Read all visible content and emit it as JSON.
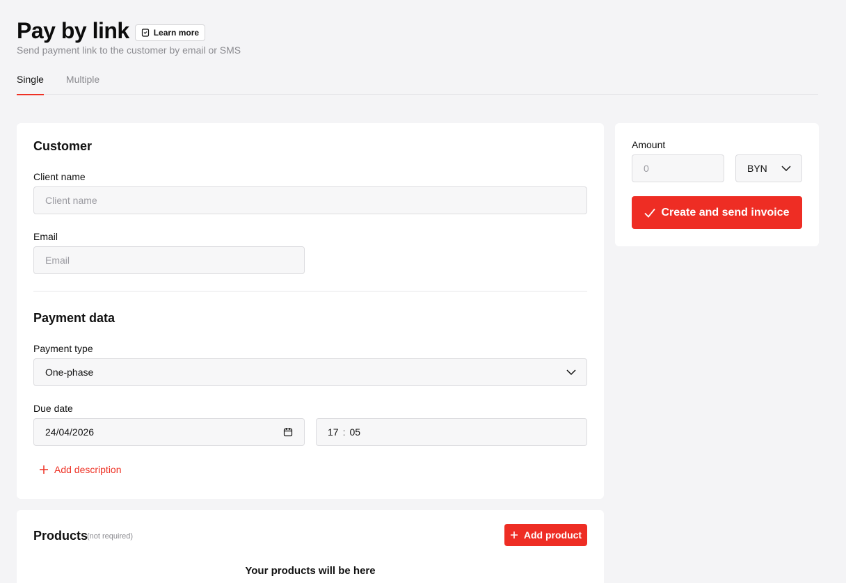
{
  "header": {
    "title": "Pay by link",
    "learn_more": "Learn more",
    "subtitle": "Send payment link to the customer by email or SMS"
  },
  "tabs": [
    {
      "label": "Single",
      "active": true
    },
    {
      "label": "Multiple",
      "active": false
    }
  ],
  "customer": {
    "section_title": "Customer",
    "client_name_label": "Client name",
    "client_name_placeholder": "Client name",
    "email_label": "Email",
    "email_placeholder": "Email"
  },
  "payment": {
    "section_title": "Payment data",
    "type_label": "Payment type",
    "type_value": "One-phase",
    "due_label": "Due date",
    "due_date": "24/04/2026",
    "due_hour": "17",
    "due_minute": "05",
    "add_description": "Add description"
  },
  "amount_panel": {
    "amount_label": "Amount",
    "amount_placeholder": "0",
    "currency": "BYN",
    "submit_label": "Create and send invoice"
  },
  "products": {
    "title": "Products",
    "note": "(not required)",
    "add_label": "Add product",
    "empty_text": "Your products will be here"
  },
  "colors": {
    "accent": "#ee2d24",
    "background": "#f4f4f6",
    "card": "#ffffff"
  }
}
